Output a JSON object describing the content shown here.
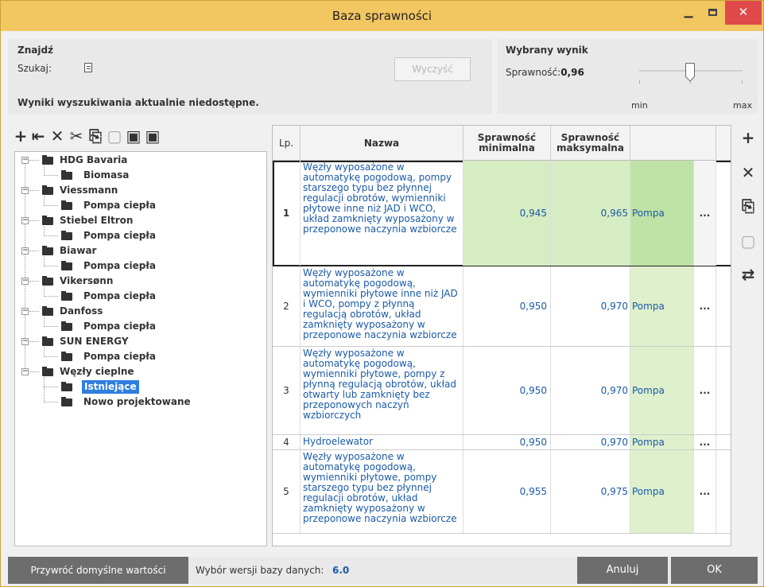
{
  "window": {
    "title": "Baza sprawności",
    "min_icon": "minimize-icon",
    "max_icon": "maximize-icon",
    "close_icon": "close-icon",
    "close_glyph": "✕"
  },
  "find_panel": {
    "title": "Znajdź",
    "search_label": "Szukaj:",
    "search_icon": "document-icon",
    "clear_label": "Wyczyść",
    "status": "Wyniki wyszukiwania aktualnie niedostępne."
  },
  "result_panel": {
    "title": "Wybrany wynik",
    "efficiency_label": "Sprawność:",
    "efficiency_value": "0,96",
    "min_label": "min",
    "max_label": "max"
  },
  "left_toolbar": [
    {
      "icon": "add-icon",
      "glyph": "+"
    },
    {
      "icon": "add-child-icon",
      "glyph": "⇤"
    },
    {
      "icon": "delete-icon",
      "glyph": "✕"
    },
    {
      "icon": "cut-icon",
      "glyph": "✂"
    },
    {
      "icon": "copy-icon",
      "glyph": "⎘"
    },
    {
      "icon": "paste-icon",
      "glyph": "▢"
    },
    {
      "icon": "save-icon",
      "glyph": "▣"
    },
    {
      "icon": "save-as-icon",
      "glyph": "▣"
    }
  ],
  "tree": [
    {
      "label": "HDG Bavaria",
      "children": [
        "Biomasa"
      ]
    },
    {
      "label": "Viessmann",
      "children": [
        "Pompa ciepła"
      ]
    },
    {
      "label": "Stiebel Eltron",
      "children": [
        "Pompa ciepła"
      ]
    },
    {
      "label": "Biawar",
      "children": [
        "Pompa ciepła"
      ]
    },
    {
      "label": "Vikersønn",
      "children": [
        "Pompa ciepła"
      ]
    },
    {
      "label": "Danfoss",
      "children": [
        "Pompa ciepła"
      ]
    },
    {
      "label": "SUN ENERGY",
      "children": [
        "Pompa ciepła"
      ]
    },
    {
      "label": "Węzły cieplne",
      "children": [
        "Istniejące",
        "Nowo projektowane"
      ]
    }
  ],
  "grid": {
    "headers": {
      "lp": "Lp.",
      "name": "Nazwa",
      "min": "Sprawność minimalna",
      "max": "Sprawność maksymalna"
    },
    "rows": [
      {
        "lp": "1",
        "name": "Węzły wyposażone w automatykę pogodową, pompy starszego typu bez płynnej regulacji obrotów, wymienniki płytowe inne niż JAD i WCO, układ zamknięty wyposażony w przeponowe naczynia wzbiorcze",
        "min": "0,945",
        "max": "0,965",
        "type": "Pompa",
        "more": "..."
      },
      {
        "lp": "2",
        "name": "Węzły wyposażone w automatykę pogodową, wymienniki płytowe inne niż  JAD i WCO, pompy z płynną regulacją obrotów, układ zamknięty wyposażony w przeponowe naczynia wzbiorcze",
        "min": "0,950",
        "max": "0,970",
        "type": "Pompa",
        "more": "..."
      },
      {
        "lp": "3",
        "name": "Węzły wyposażone w automatykę pogodową, wymienniki płytowe, pompy z płynną regulacją obrotów, układ otwarty lub zamknięty bez przeponowych naczyń wzbiorczych",
        "min": "0,950",
        "max": "0,970",
        "type": "Pompa",
        "more": "..."
      },
      {
        "lp": "4",
        "name": "Hydroelewator",
        "min": "0,950",
        "max": "0,970",
        "type": "Pompa",
        "more": "..."
      },
      {
        "lp": "5",
        "name": "Węzły wyposażone w automatykę pogodową, wymienniki płytowe, pompy starszego typu bez płynnej regulacji obrotów, układ zamknięty wyposażony w przeponowe naczynia wzbiorcze",
        "min": "0,955",
        "max": "0,975",
        "type": "Pompa",
        "more": "..."
      }
    ]
  },
  "right_toolbar": [
    {
      "icon": "add-icon",
      "glyph": "+"
    },
    {
      "icon": "delete-icon",
      "glyph": "✕"
    },
    {
      "icon": "copy-icon",
      "glyph": "⎘"
    },
    {
      "icon": "paste-icon",
      "glyph": "▢"
    },
    {
      "icon": "refresh-icon",
      "glyph": "⇄"
    }
  ],
  "bottom": {
    "restore_label": "Przywróć domyślne wartości",
    "version_label": "Wybór wersji bazy danych:",
    "version_value": "6.0",
    "cancel_label": "Anuluj",
    "ok_label": "OK"
  }
}
